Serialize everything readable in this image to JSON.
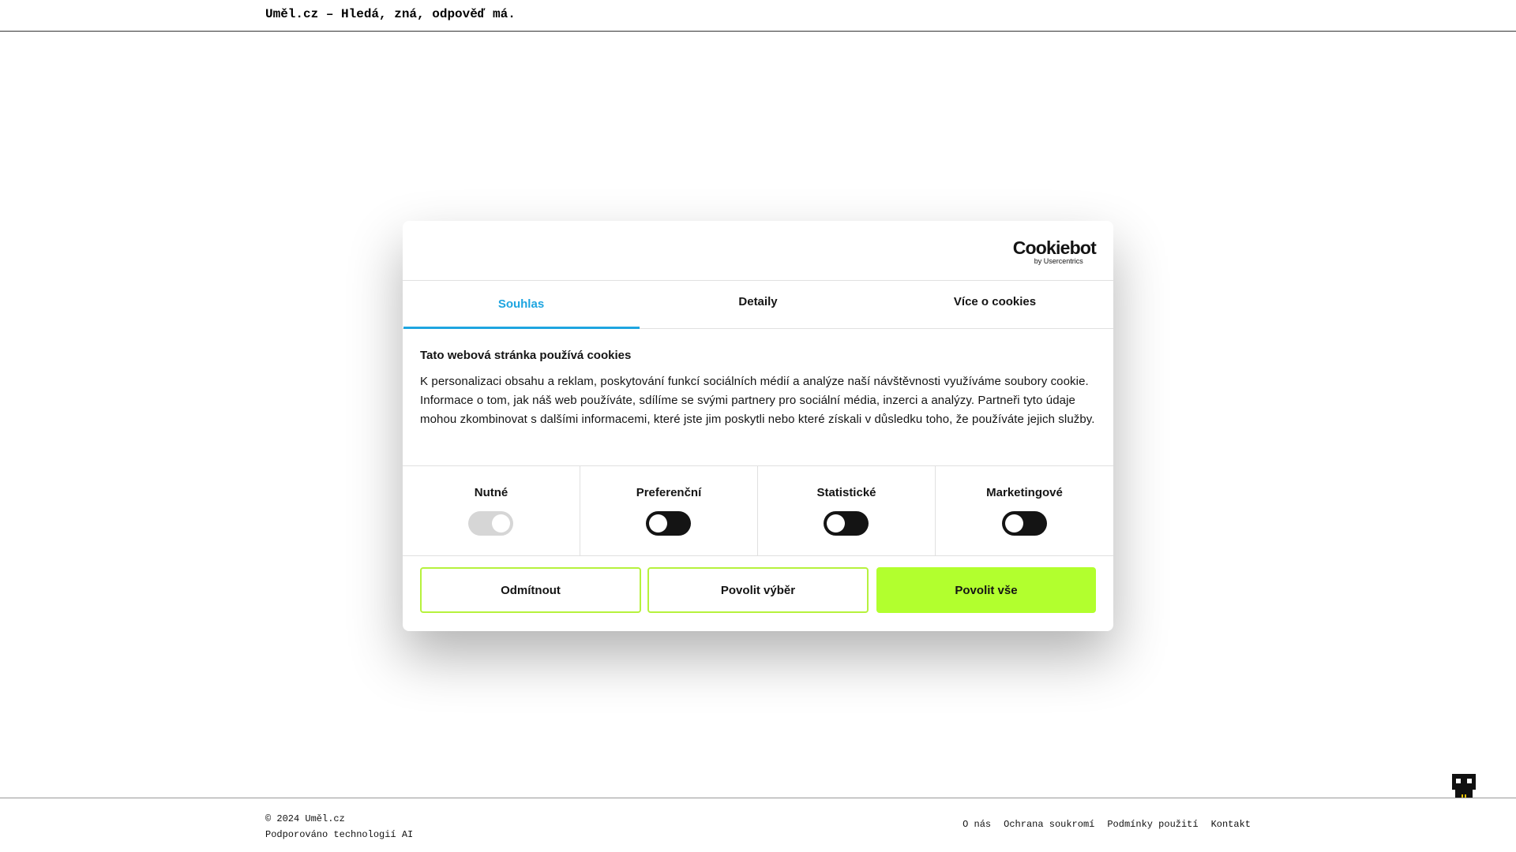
{
  "header": {
    "title": "Uměl.cz – Hledá, zná, odpověď má."
  },
  "cookie_dialog": {
    "logo": {
      "brand": "Cookiebot",
      "sub": "by Usercentrics"
    },
    "tabs": [
      {
        "label": "Souhlas",
        "active": true
      },
      {
        "label": "Detaily",
        "active": false
      },
      {
        "label": "Více o cookies",
        "active": false
      }
    ],
    "heading": "Tato webová stránka používá cookies",
    "text": "K personalizaci obsahu a reklam, poskytování funkcí sociálních médií a analýze naší návštěvnosti využíváme soubory cookie. Informace o tom, jak náš web používáte, sdílíme se svými partnery pro sociální média, inzerci a analýzy. Partneři tyto údaje mohou zkombinovat s dalšími informacemi, které jste jim poskytli nebo které získali v důsledku toho, že používáte jejich služby.",
    "toggles": [
      {
        "label": "Nutné",
        "checked": true,
        "disabled": true
      },
      {
        "label": "Preferenční",
        "checked": false,
        "disabled": false
      },
      {
        "label": "Statistické",
        "checked": false,
        "disabled": false
      },
      {
        "label": "Marketingové",
        "checked": false,
        "disabled": false
      }
    ],
    "buttons": {
      "decline": "Odmítnout",
      "allow_selection": "Povolit výběr",
      "allow_all": "Povolit vše"
    },
    "colors": {
      "accent_tab": "#1ea5e0",
      "accent_button": "#b2ff2e",
      "toggle_off": "#141414"
    }
  },
  "footer": {
    "copyright": "© 2024 Uměl.cz",
    "powered": "Podporováno technologií AI",
    "links": [
      "O nás",
      "Ochrana soukromí",
      "Podmínky použití",
      "Kontakt"
    ]
  },
  "mascot_icon": "robot-mascot-icon"
}
